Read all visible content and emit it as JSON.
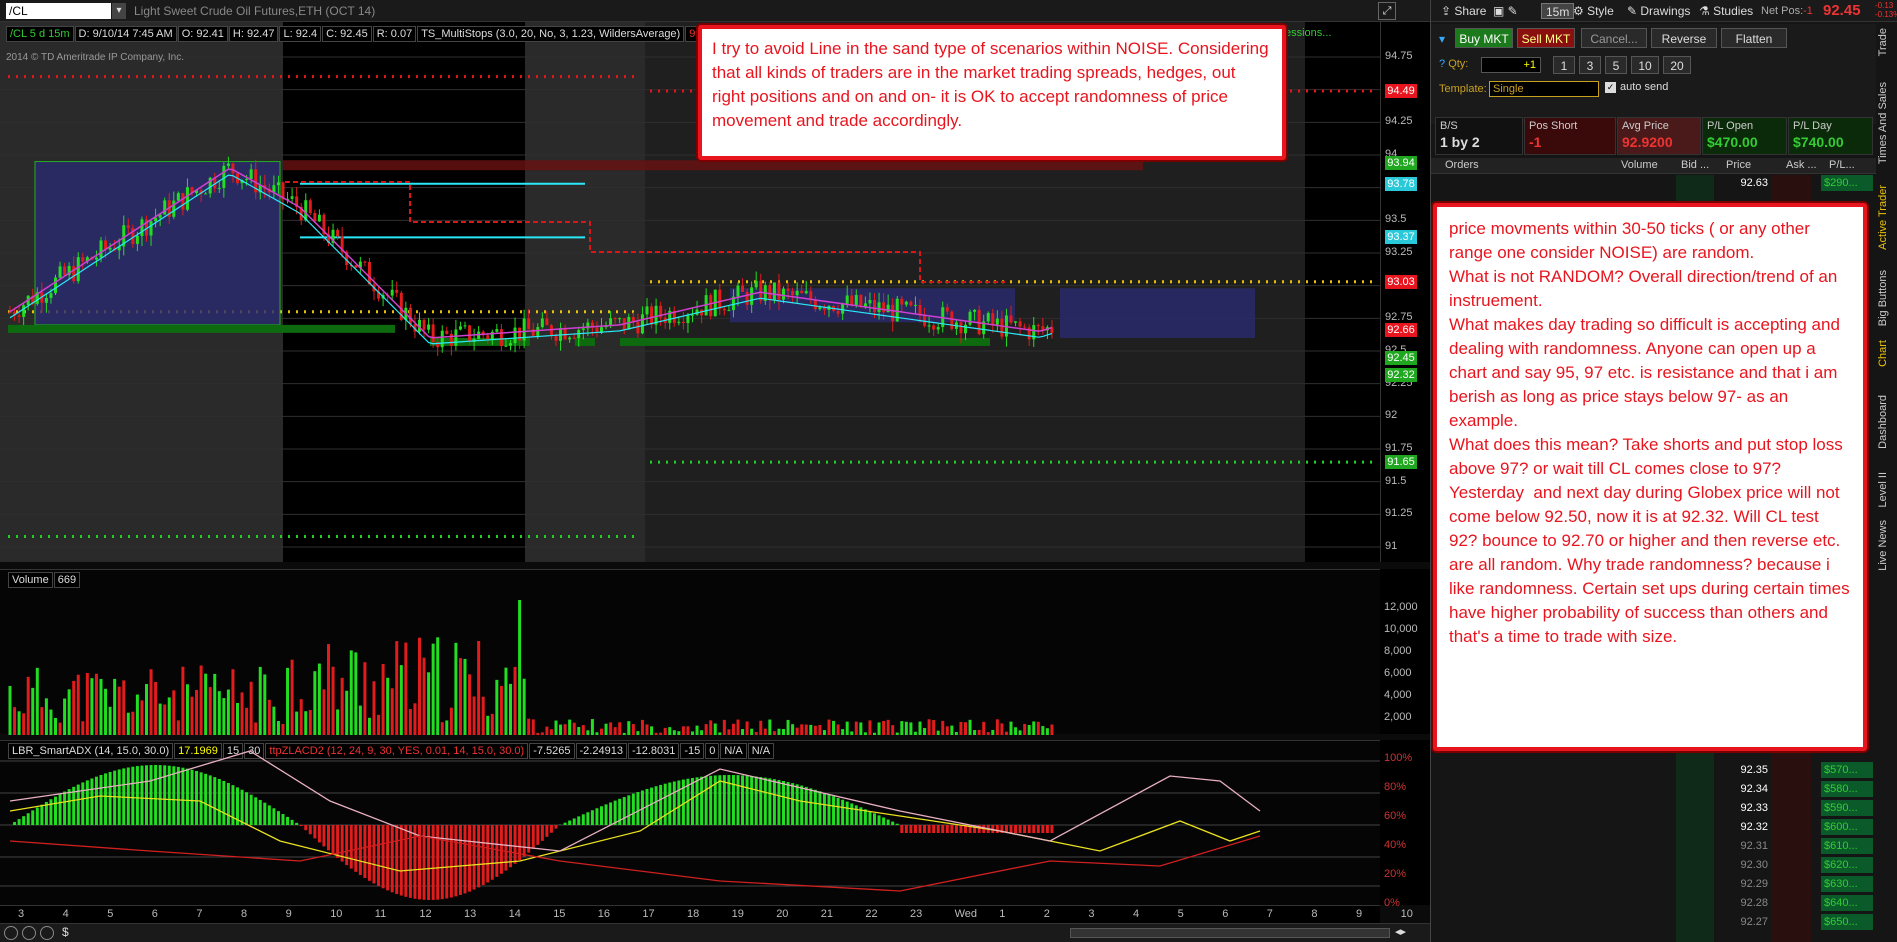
{
  "toolbar": {
    "symbol": "/CL",
    "description": "Light Sweet Crude Oil Futures,ETH (OCT 14)",
    "share": "Share",
    "interval": "15m",
    "style": "Style",
    "drawings": "Drawings",
    "studies": "Studies",
    "net_pos_label": "Net Pos:",
    "net_pos": "-1",
    "last_price": "92.45",
    "change_top": "-0.13",
    "change_pct": "-0.13%"
  },
  "chart": {
    "info": [
      "/CL 5 d 15m",
      "D: 9/10/14 7:45 AM",
      "O: 92.41",
      "H: 92.47",
      "L: 92.4",
      "C: 92.45",
      "R: 0.07",
      "TS_MultiStops (3.0, 20, No, 3, 1.23, WildersAverage)",
      "92.8"
    ],
    "copyright": "2014 © TD Ameritrade IP Company, Inc.",
    "price_labels": [
      "94.75",
      "94.5",
      "94.25",
      "94",
      "93.75",
      "93.5",
      "93.25",
      "93",
      "92.75",
      "92.5",
      "92.25",
      "92",
      "91.75",
      "91.5",
      "91.25",
      "91"
    ],
    "tags": [
      {
        "v": "94.49",
        "c": "#e8141e"
      },
      {
        "v": "93.94",
        "c": "#1fa81f"
      },
      {
        "v": "93.78",
        "c": "#29c9d9"
      },
      {
        "v": "93.37",
        "c": "#29c9d9"
      },
      {
        "v": "93.03",
        "c": "#e8141e"
      },
      {
        "v": "92.66",
        "c": "#e8141e"
      },
      {
        "v": "92.45",
        "c": "#1fa81f"
      },
      {
        "v": "92.32",
        "c": "#1fa81f"
      },
      {
        "v": "91.65",
        "c": "#1fa81f"
      }
    ],
    "sessions_text": "essions..."
  },
  "callout1": "I try to avoid Line in the sand type of  scenarios within NOISE. Considering that all kinds of traders are in the market trading spreads, hedges, out right positions  and on and on- it is OK to accept randomness of price movement and trade accordingly.",
  "callout2": "price movments within 30-50 ticks ( or any other range one consider NOISE) are random.\nWhat is not RANDOM? Overall direction/trend of an instruement.\nWhat makes day trading so difficult is accepting and dealing with randomness. Anyone can open up a chart and say 95, 97 etc. is resistance and that i am berish as long as price stays below 97- as an example.\nWhat does this mean? Take shorts and put stop loss above 97? or wait till CL comes close to 97?\nYesterday  and next day during Globex price will not come below 92.50, now it is at 92.32. Will CL test 92? bounce to 92.70 or higher and then reverse etc. are all random. Why trade randomness? because i like randomness. Certain set ups during certain times have higher probability of success than others and that's a time to trade with size.",
  "volume": {
    "label": "Volume",
    "value": "669",
    "scale": [
      "12,000",
      "10,000",
      "8,000",
      "6,000",
      "4,000",
      "2,000"
    ]
  },
  "osc": {
    "items": [
      "LBR_SmartADX (14, 15.0, 30.0)",
      "17.1969",
      "15",
      "30",
      "ttpZLACD2 (12, 24, 9, 30, YES, 0.01, 14, 15.0, 30.0)",
      "-7.5265",
      "-2.24913",
      "-12.8031",
      "-15",
      "0",
      "N/A",
      "N/A"
    ],
    "scale": [
      "100%",
      "80%",
      "60%",
      "40%",
      "20%",
      "0%"
    ]
  },
  "xaxis": [
    "3",
    "4",
    "5",
    "6",
    "7",
    "8",
    "9",
    "10",
    "11",
    "12",
    "13",
    "14",
    "15",
    "16",
    "17",
    "18",
    "19",
    "20",
    "21",
    "22",
    "23",
    "Wed",
    "1",
    "2",
    "3",
    "4",
    "5",
    "6",
    "7",
    "8",
    "9",
    "10"
  ],
  "trade": {
    "buy": "Buy MKT",
    "sell": "Sell MKT",
    "cancel": "Cancel...",
    "reverse": "Reverse",
    "flatten": "Flatten",
    "qty_label": "Qty:",
    "qty": "+1",
    "qty_opts": [
      "1",
      "3",
      "5",
      "10",
      "20"
    ],
    "template_label": "Template:",
    "template": "Single",
    "autosend": "auto send"
  },
  "position": {
    "bs_label": "B/S",
    "bs": "1 by 2",
    "pos_label": "Pos Short",
    "pos": "-1",
    "avg_label": "Avg Price",
    "avg": "92.9200",
    "plopen_label": "P/L Open",
    "plopen": "$470.00",
    "plday_label": "P/L Day",
    "plday": "$740.00"
  },
  "ladder": {
    "headers": [
      "Orders",
      "Volume",
      "Bid ...",
      "Price",
      "Ask ...",
      "P/L..."
    ],
    "top": {
      "price": "92.63",
      "pl": "$290..."
    },
    "rows": [
      {
        "p": "92.35",
        "pl": "$570..."
      },
      {
        "p": "92.34",
        "pl": "$580..."
      },
      {
        "p": "92.33",
        "pl": "$590..."
      },
      {
        "p": "92.32",
        "pl": "$600..."
      },
      {
        "p": "92.31",
        "pl": "$610..."
      },
      {
        "p": "92.30",
        "pl": "$620..."
      },
      {
        "p": "92.29",
        "pl": "$630..."
      },
      {
        "p": "92.28",
        "pl": "$640..."
      },
      {
        "p": "92.27",
        "pl": "$650..."
      }
    ]
  },
  "side_tabs": [
    "Trade",
    "Times And Sales",
    "Active Trader",
    "Big Buttons",
    "Chart",
    "Dashboard",
    "Level II",
    "Live News"
  ]
}
